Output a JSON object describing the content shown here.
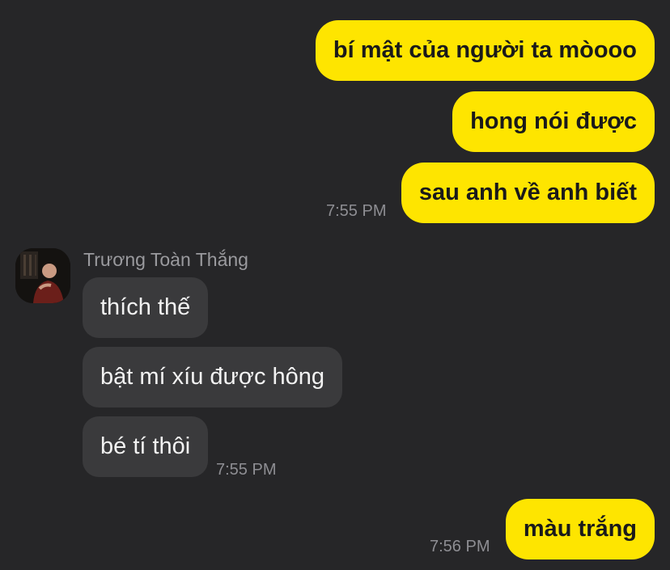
{
  "conversation": {
    "outgoing_group_1": {
      "messages": [
        "bí mật của người ta mòooo",
        "hong nói được",
        "sau anh về anh biết"
      ],
      "time": "7:55 PM"
    },
    "incoming_group": {
      "sender_name": "Trương Toàn Thắng",
      "avatar_icon": "user-photo-icon",
      "messages": [
        "thích thế",
        "bật mí xíu được hông",
        "bé tí thôi"
      ],
      "time": "7:55 PM"
    },
    "outgoing_group_2": {
      "messages": [
        "màu trắng"
      ],
      "time": "7:56 PM"
    }
  },
  "colors": {
    "background": "#262628",
    "outgoing_bubble": "#fee500",
    "incoming_bubble": "#3a3a3c",
    "timestamp": "#8e8e93"
  }
}
